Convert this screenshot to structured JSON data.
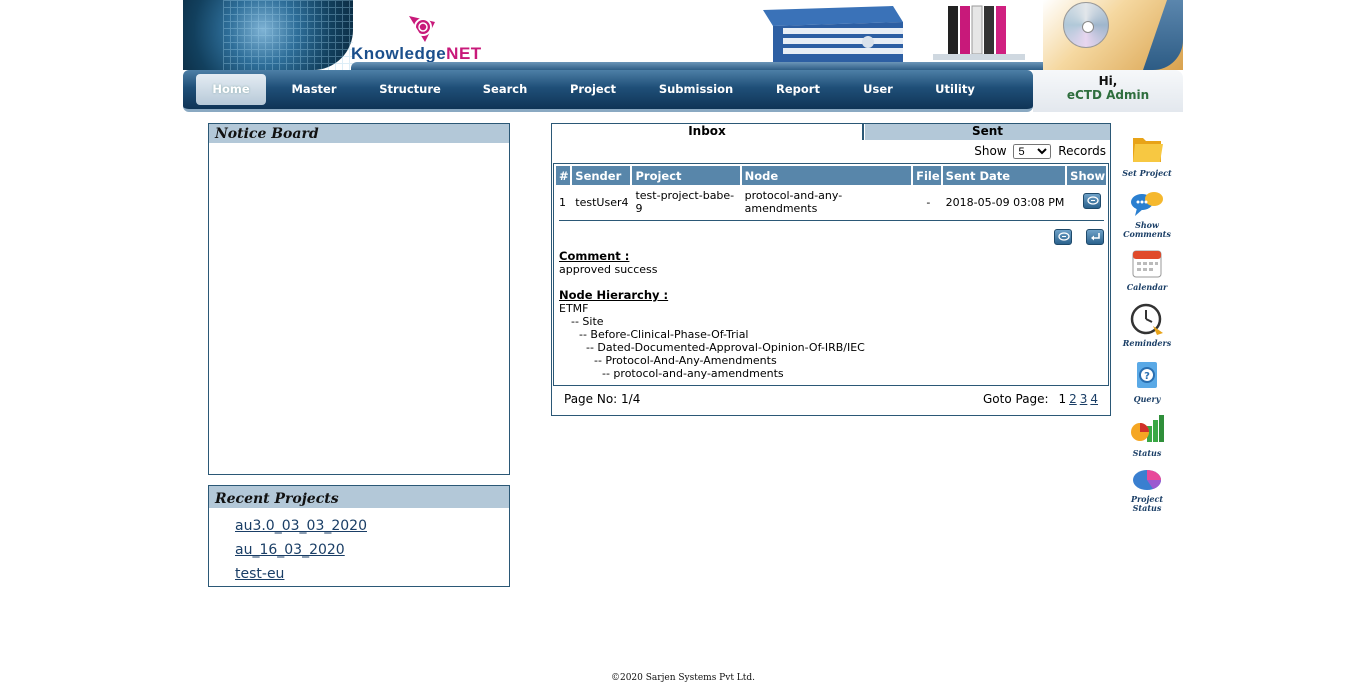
{
  "header": {
    "logo_k": "Knowledge",
    "logo_n": "NET"
  },
  "nav": {
    "items": [
      {
        "label": "Home"
      },
      {
        "label": "Master"
      },
      {
        "label": "Structure"
      },
      {
        "label": "Search"
      },
      {
        "label": "Project"
      },
      {
        "label": "Submission"
      },
      {
        "label": "Report"
      },
      {
        "label": "User"
      },
      {
        "label": "Utility"
      }
    ]
  },
  "greeting": {
    "hi": "Hi,",
    "user": "eCTD Admin"
  },
  "notice_board": {
    "title": "Notice Board"
  },
  "recent_projects": {
    "title": "Recent Projects",
    "items": [
      {
        "label": "au3.0_03_03_2020"
      },
      {
        "label": "au_16_03_2020"
      },
      {
        "label": "test-eu"
      }
    ]
  },
  "inbox": {
    "tabs": {
      "inbox": "Inbox",
      "sent": "Sent"
    },
    "show_label": "Show",
    "show_value": "5",
    "records_label": "Records",
    "columns": [
      "#",
      "Sender",
      "Project",
      "Node",
      "File",
      "Sent Date",
      "Show"
    ],
    "row": {
      "num": "1",
      "sender": "testUser4",
      "project": "test-project-babe-9",
      "node": "protocol-and-any-amendments",
      "file": "-",
      "sent_date": "2018-05-09 03:08 PM"
    },
    "comment_heading": "Comment :",
    "comment_text": "approved success",
    "hierarchy_heading": "Node Hierarchy :",
    "hierarchy": [
      "ETMF",
      "-- Site",
      "-- Before-Clinical-Phase-Of-Trial",
      "-- Dated-Documented-Approval-Opinion-Of-IRB/IEC",
      "-- Protocol-And-Any-Amendments",
      "-- protocol-and-any-amendments"
    ],
    "page_no": "Page No: 1/4",
    "goto_label": "Goto Page:",
    "pages": [
      "1",
      "2",
      "3",
      "4"
    ]
  },
  "sidebar": {
    "items": [
      {
        "label": "Set Project",
        "icon": "folder-icon"
      },
      {
        "label": "Show Comments",
        "icon": "comments-icon"
      },
      {
        "label": "Calendar",
        "icon": "calendar-icon"
      },
      {
        "label": "Reminders",
        "icon": "clock-icon"
      },
      {
        "label": "Query",
        "icon": "query-icon"
      },
      {
        "label": "Status",
        "icon": "status-chart-icon"
      },
      {
        "label": "Project Status",
        "icon": "pie-chart-icon"
      }
    ]
  },
  "footer": {
    "copyright": "©2020 Sarjen Systems Pvt Ltd."
  }
}
